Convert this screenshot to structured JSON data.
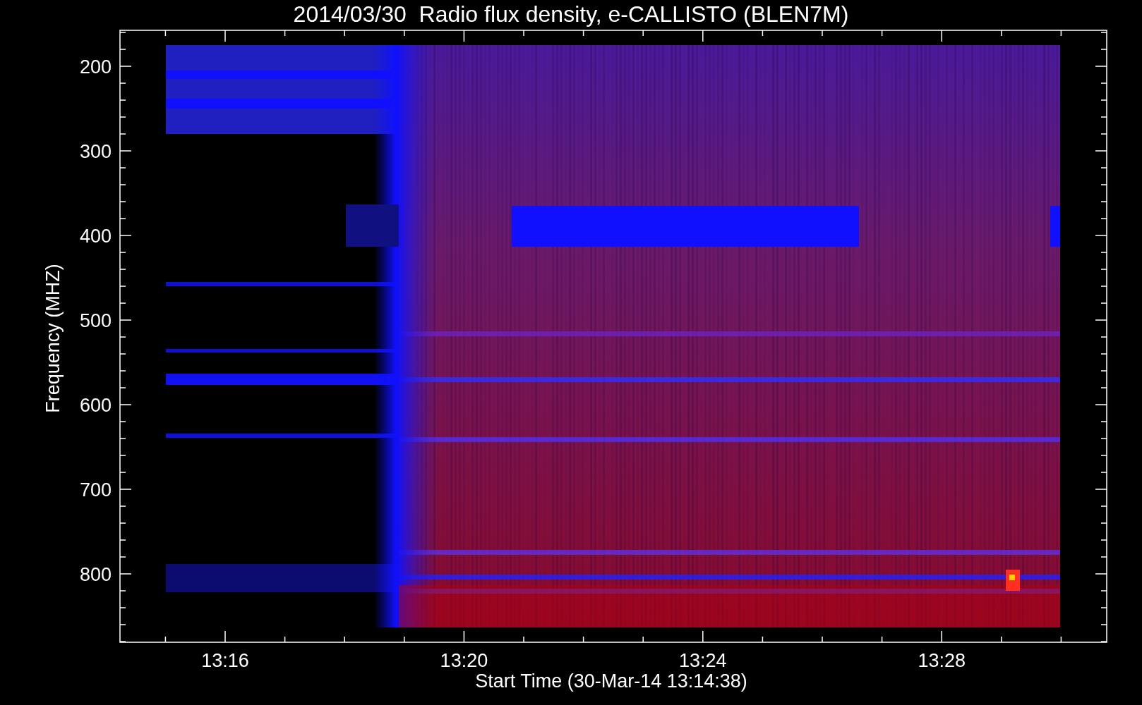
{
  "title": "2014/03/30  Radio flux density, e-CALLISTO (BLEN7M)",
  "y_axis": {
    "label": "Frequency (MHZ)",
    "ticks": [
      "200",
      "300",
      "400",
      "500",
      "600",
      "700",
      "800"
    ]
  },
  "x_axis": {
    "label": "Start Time (30-Mar-14 13:14:38)",
    "ticks": [
      "13:16",
      "13:20",
      "13:24",
      "13:28"
    ]
  }
}
